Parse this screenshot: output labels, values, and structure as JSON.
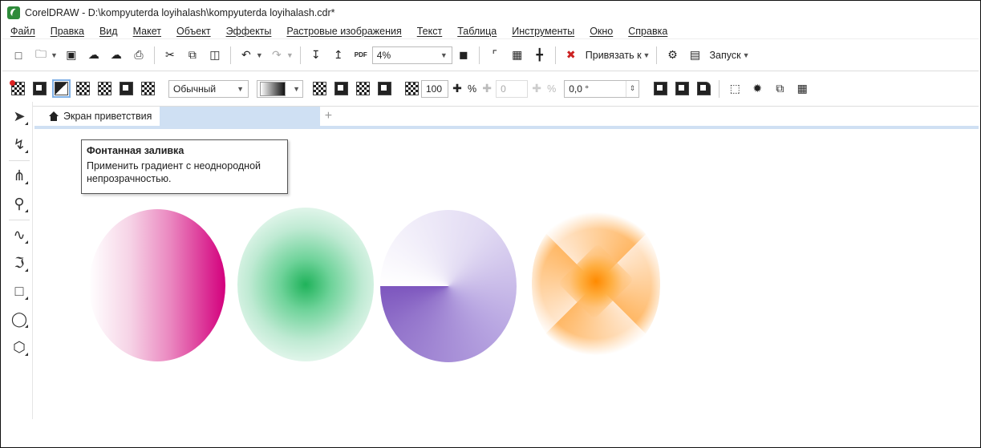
{
  "window": {
    "title": "CorelDRAW - D:\\kompyuterda loyihalash\\kompyuterda loyihalash.cdr*"
  },
  "menu": [
    "Файл",
    "Правка",
    "Вид",
    "Макет",
    "Объект",
    "Эффекты",
    "Растровые изображения",
    "Текст",
    "Таблица",
    "Инструменты",
    "Окно",
    "Справка"
  ],
  "standard_toolbar": {
    "zoom_value": "4%",
    "snap_label": "Привязать к",
    "launch_label": "Запуск",
    "pdf_label": "PDF"
  },
  "property_bar": {
    "blend_mode": "Обычный",
    "opacity_value": "100",
    "percent_symbol": "%",
    "secondary_value": "0",
    "angle_value": "0,0 °"
  },
  "tabs": {
    "home_label": "Экран приветствия",
    "add_label": "+"
  },
  "tooltip": {
    "title": "Фонтанная заливка",
    "body_line1": "Применить градиент с неоднородной",
    "body_line2": "непрозрачностью."
  },
  "colors": {
    "pink": "#d3007d",
    "green": "#1fb25a",
    "purple": "#7d56be",
    "orange": "#ff8a00",
    "tab_blue": "#cfe0f3"
  }
}
